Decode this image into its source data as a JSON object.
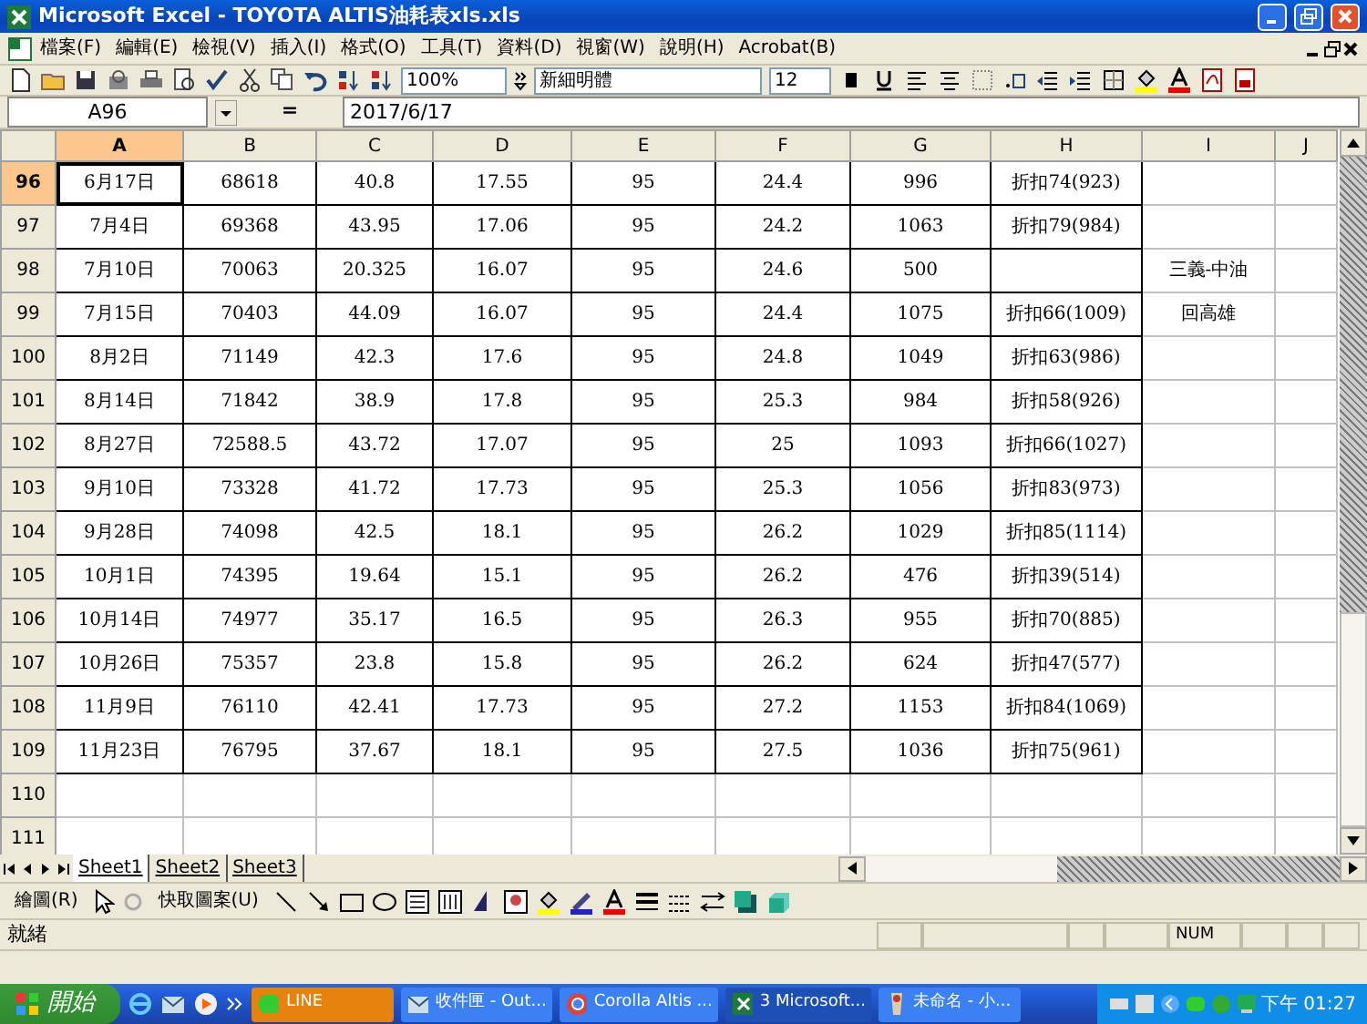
{
  "window": {
    "title": "Microsoft Excel - TOYOTA ALTIS油耗表xls.xls"
  },
  "menu": [
    {
      "label": "檔案(F)"
    },
    {
      "label": "編輯(E)"
    },
    {
      "label": "檢視(V)"
    },
    {
      "label": "插入(I)"
    },
    {
      "label": "格式(O)"
    },
    {
      "label": "工具(T)"
    },
    {
      "label": "資料(D)"
    },
    {
      "label": "視窗(W)"
    },
    {
      "label": "說明(H)"
    },
    {
      "label": "Acrobat(B)"
    }
  ],
  "toolbar": {
    "zoom": "100%",
    "font": "新細明體",
    "font_size": "12"
  },
  "formula_bar": {
    "name_box": "A96",
    "equals": "=",
    "formula": "2017/6/17"
  },
  "columns": [
    {
      "label": "A",
      "selected": true
    },
    {
      "label": "B",
      "selected": false
    },
    {
      "label": "C",
      "selected": false
    },
    {
      "label": "D",
      "selected": false
    },
    {
      "label": "E",
      "selected": false
    },
    {
      "label": "F",
      "selected": false
    },
    {
      "label": "G",
      "selected": false
    },
    {
      "label": "H",
      "selected": false
    },
    {
      "label": "I",
      "selected": false
    },
    {
      "label": "J",
      "selected": false
    }
  ],
  "rows": [
    {
      "number": "96",
      "selected": true,
      "bordered": true,
      "cells": [
        "6月17日",
        "68618",
        "40.8",
        "17.55",
        "95",
        "24.4",
        "996",
        "折扣74(923)",
        ""
      ]
    },
    {
      "number": "97",
      "selected": false,
      "bordered": true,
      "cells": [
        "7月4日",
        "69368",
        "43.95",
        "17.06",
        "95",
        "24.2",
        "1063",
        "折扣79(984)",
        ""
      ]
    },
    {
      "number": "98",
      "selected": false,
      "bordered": true,
      "cells": [
        "7月10日",
        "70063",
        "20.325",
        "16.07",
        "95",
        "24.6",
        "500",
        "",
        "三義-中油"
      ]
    },
    {
      "number": "99",
      "selected": false,
      "bordered": true,
      "cells": [
        "7月15日",
        "70403",
        "44.09",
        "16.07",
        "95",
        "24.4",
        "1075",
        "折扣66(1009)",
        "回高雄"
      ]
    },
    {
      "number": "100",
      "selected": false,
      "bordered": true,
      "cells": [
        "8月2日",
        "71149",
        "42.3",
        "17.6",
        "95",
        "24.8",
        "1049",
        "折扣63(986)",
        ""
      ]
    },
    {
      "number": "101",
      "selected": false,
      "bordered": true,
      "cells": [
        "8月14日",
        "71842",
        "38.9",
        "17.8",
        "95",
        "25.3",
        "984",
        "折扣58(926)",
        ""
      ]
    },
    {
      "number": "102",
      "selected": false,
      "bordered": true,
      "cells": [
        "8月27日",
        "72588.5",
        "43.72",
        "17.07",
        "95",
        "25",
        "1093",
        "折扣66(1027)",
        ""
      ]
    },
    {
      "number": "103",
      "selected": false,
      "bordered": true,
      "cells": [
        "9月10日",
        "73328",
        "41.72",
        "17.73",
        "95",
        "25.3",
        "1056",
        "折扣83(973)",
        ""
      ]
    },
    {
      "number": "104",
      "selected": false,
      "bordered": true,
      "cells": [
        "9月28日",
        "74098",
        "42.5",
        "18.1",
        "95",
        "26.2",
        "1029",
        "折扣85(1114)",
        ""
      ]
    },
    {
      "number": "105",
      "selected": false,
      "bordered": true,
      "cells": [
        "10月1日",
        "74395",
        "19.64",
        "15.1",
        "95",
        "26.2",
        "476",
        "折扣39(514)",
        ""
      ]
    },
    {
      "number": "106",
      "selected": false,
      "bordered": true,
      "cells": [
        "10月14日",
        "74977",
        "35.17",
        "16.5",
        "95",
        "26.3",
        "955",
        "折扣70(885)",
        ""
      ]
    },
    {
      "number": "107",
      "selected": false,
      "bordered": true,
      "cells": [
        "10月26日",
        "75357",
        "23.8",
        "15.8",
        "95",
        "26.2",
        "624",
        "折扣47(577)",
        ""
      ]
    },
    {
      "number": "108",
      "selected": false,
      "bordered": true,
      "cells": [
        "11月9日",
        "76110",
        "42.41",
        "17.73",
        "95",
        "27.2",
        "1153",
        "折扣84(1069)",
        ""
      ]
    },
    {
      "number": "109",
      "selected": false,
      "bordered": true,
      "cells": [
        "11月23日",
        "76795",
        "37.67",
        "18.1",
        "95",
        "27.5",
        "1036",
        "折扣75(961)",
        ""
      ]
    },
    {
      "number": "110",
      "selected": false,
      "bordered": false,
      "cells": [
        "",
        "",
        "",
        "",
        "",
        "",
        "",
        "",
        ""
      ]
    },
    {
      "number": "111",
      "selected": false,
      "bordered": false,
      "cells": [
        "",
        "",
        "",
        "",
        "",
        "",
        "",
        "",
        ""
      ]
    }
  ],
  "sheet_tabs": [
    {
      "label": "Sheet1",
      "selected": true
    },
    {
      "label": "Sheet2",
      "selected": false
    },
    {
      "label": "Sheet3",
      "selected": false
    }
  ],
  "drawing_toolbar": {
    "draw_menu": "繪圖(R)",
    "autoshapes_menu": "快取圖案(U)"
  },
  "status_bar": {
    "status": "就緒",
    "num_lock": "NUM"
  },
  "taskbar": {
    "start": "開始",
    "buttons": [
      {
        "label": "LINE",
        "kind": "line",
        "flashing": true,
        "selected": false
      },
      {
        "label": "收件匣 - Out...",
        "kind": "mail",
        "flashing": false,
        "selected": false
      },
      {
        "label": "Corolla Altis ...",
        "kind": "browser",
        "flashing": false,
        "selected": false
      },
      {
        "label": "3 Microsoft...",
        "kind": "excel",
        "flashing": false,
        "selected": true
      },
      {
        "label": "未命名 - 小...",
        "kind": "paint",
        "flashing": false,
        "selected": false
      }
    ],
    "clock": "下午 01:27"
  }
}
